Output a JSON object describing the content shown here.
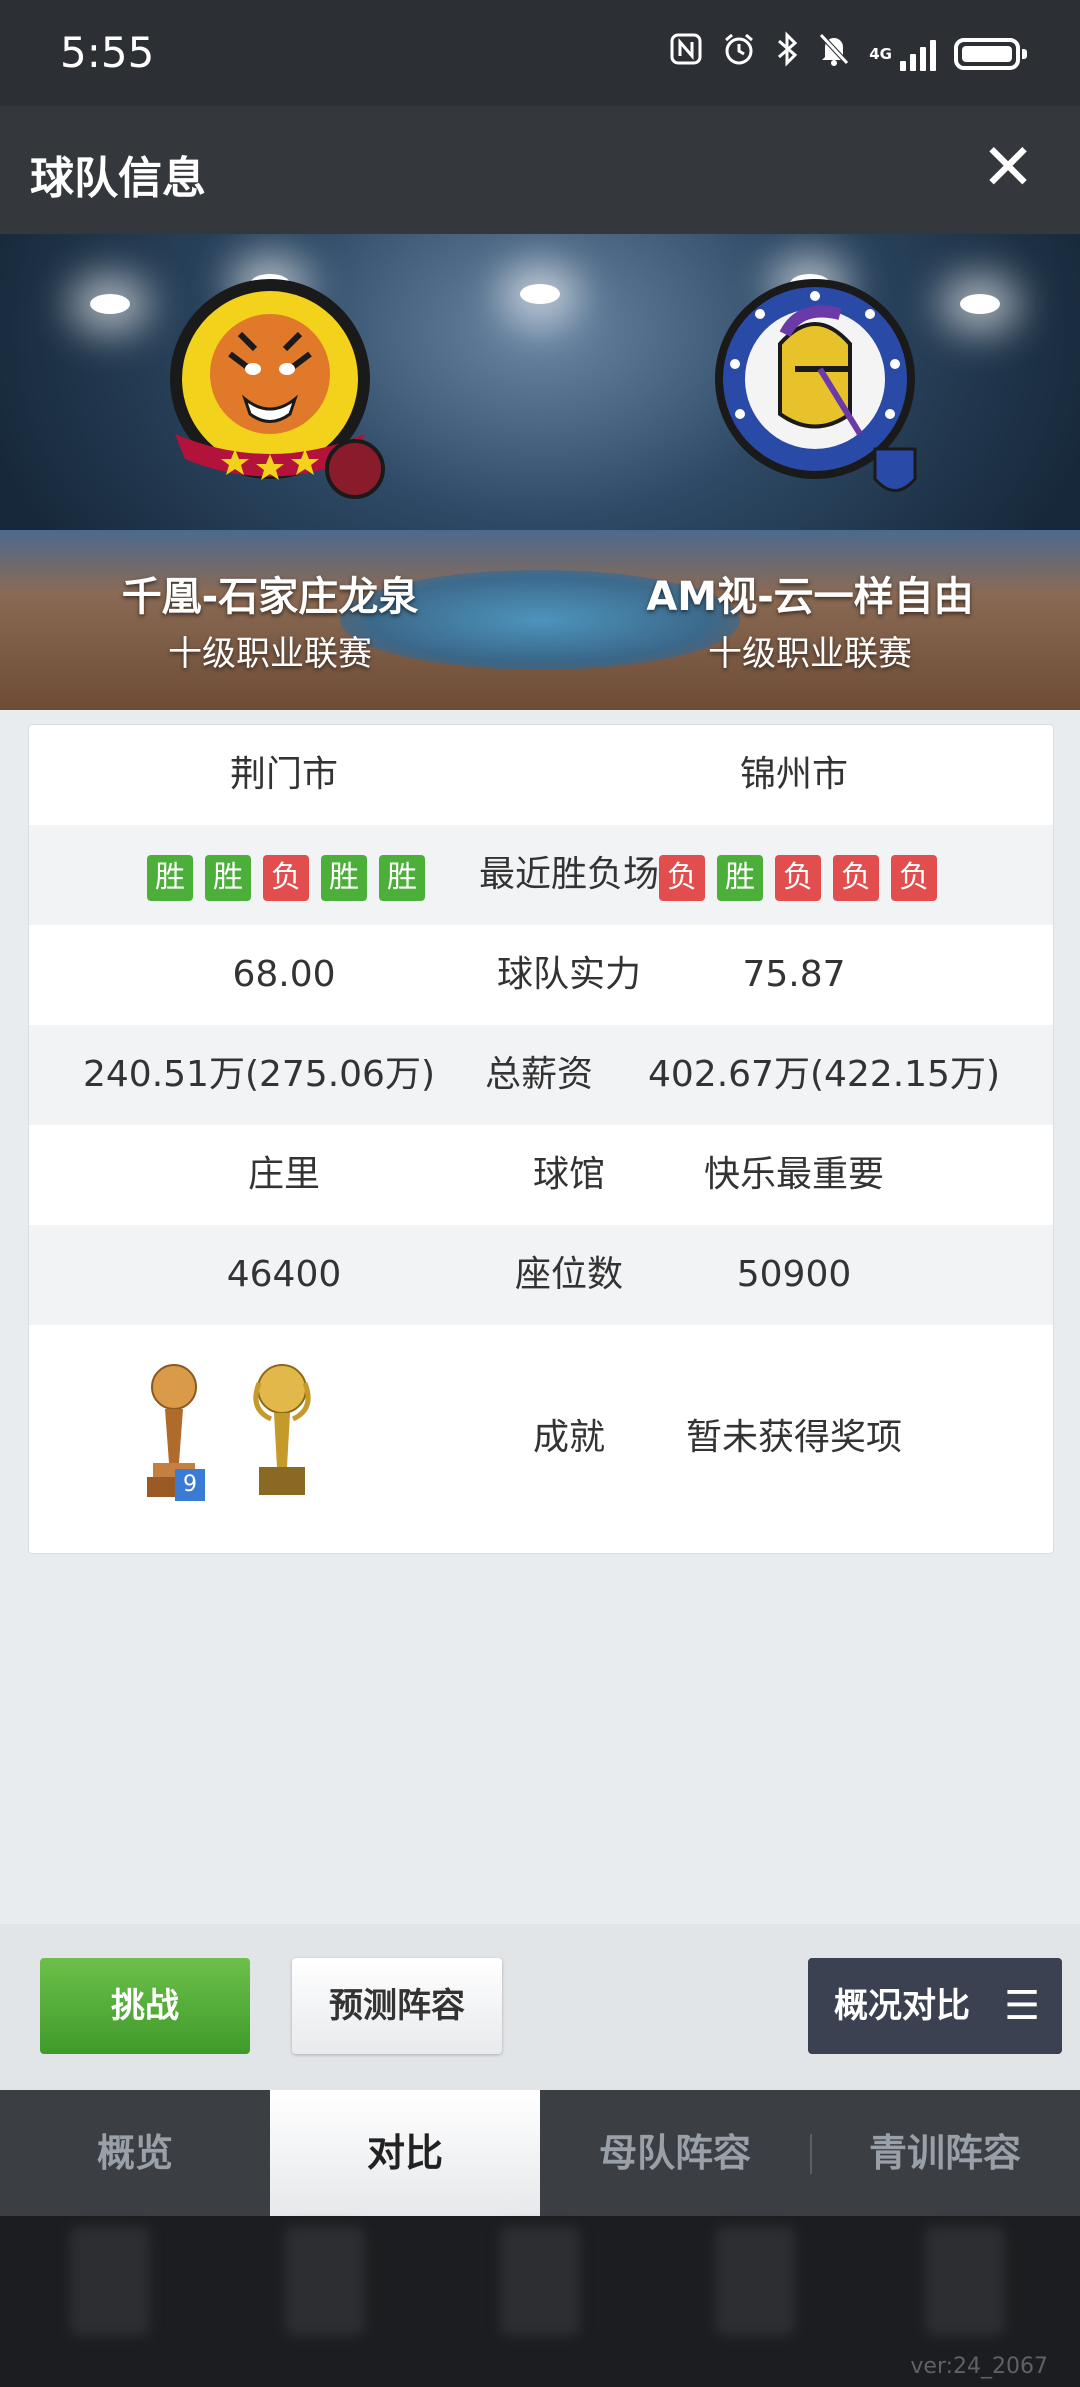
{
  "status_bar": {
    "time": "5:55",
    "network": "4G",
    "icons": [
      "nfc-icon",
      "alarm-icon",
      "bluetooth-icon",
      "mute-icon",
      "signal-icon",
      "battery-icon"
    ],
    "battery_fraction": 1.0
  },
  "header": {
    "title": "球队信息",
    "close": "✕"
  },
  "banner": {
    "left_team": {
      "name": "千凰-石家庄龙泉",
      "league": "十级职业联赛",
      "logo": "tiger-logo"
    },
    "right_team": {
      "name": "AM视-云一样自由",
      "league": "十级职业联赛",
      "logo": "knight-logo"
    }
  },
  "compare": {
    "city": {
      "left": "荆门市",
      "right": "锦州市"
    },
    "recent": {
      "label": "最近胜负场",
      "left": [
        "胜",
        "胜",
        "负",
        "胜",
        "胜"
      ],
      "right": [
        "负",
        "胜",
        "负",
        "负",
        "负"
      ]
    },
    "strength": {
      "label": "球队实力",
      "left": "68.00",
      "right": "75.87"
    },
    "salary": {
      "label": "总薪资",
      "left": "240.51万(275.06万)",
      "right": "402.67万(422.15万)"
    },
    "arena": {
      "label": "球馆",
      "left": "庄里",
      "right": "快乐最重要"
    },
    "seats": {
      "label": "座位数",
      "left": "46400",
      "right": "50900"
    },
    "achievements": {
      "label": "成就",
      "left_trophy_count": "9",
      "right": "暂未获得奖项"
    }
  },
  "actions": {
    "challenge": "挑战",
    "predict": "预测阵容",
    "overview_compare": "概况对比",
    "menu_icon": "☰"
  },
  "tabs": [
    "概览",
    "对比",
    "母队阵容",
    "青训阵容"
  ],
  "active_tab": 1,
  "version": "ver:24_2067",
  "colors": {
    "win": "#4caf3a",
    "loss": "#e24e4e",
    "header": "#34383d",
    "challenge": "#4caf3a"
  }
}
